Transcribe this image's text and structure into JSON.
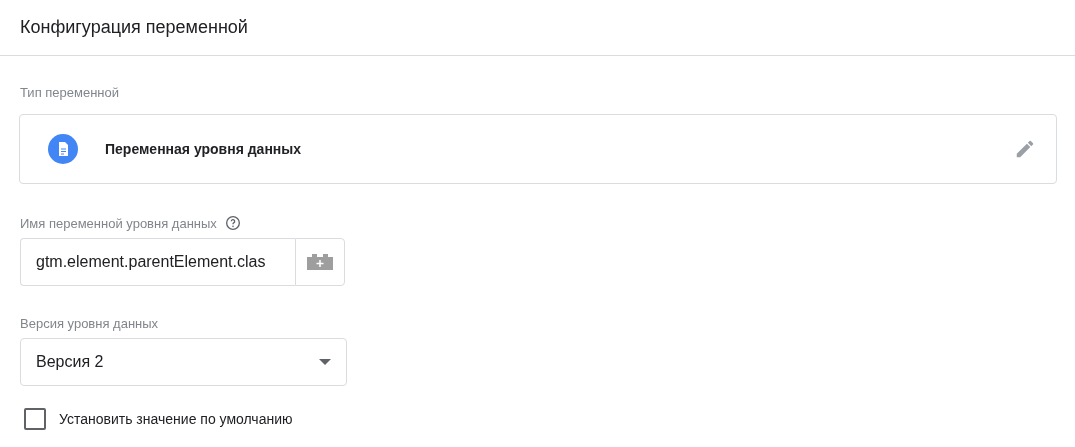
{
  "header": {
    "title": "Конфигурация переменной"
  },
  "variable_type": {
    "label": "Тип переменной",
    "value": "Переменная уровня данных"
  },
  "name_field": {
    "label": "Имя переменной уровня данных",
    "value": "gtm.element.parentElement.clas"
  },
  "version_field": {
    "label": "Версия уровня данных",
    "value": "Версия 2"
  },
  "default_value": {
    "label": "Установить значение по умолчанию",
    "checked": false
  }
}
